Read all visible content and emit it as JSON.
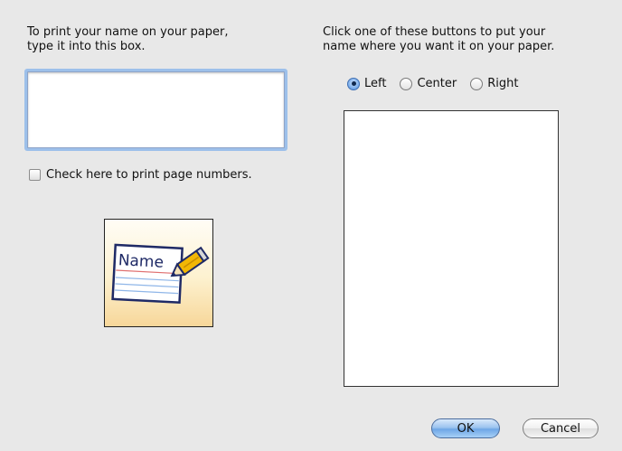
{
  "left_panel": {
    "instruction": "To print your name on your paper,\ntype it into this box.",
    "name_field": {
      "value": "",
      "placeholder": ""
    },
    "page_numbers_checkbox": {
      "label": "Check here to print page numbers.",
      "checked": false
    },
    "preview_icon": {
      "name": "name-tag-pencil-icon",
      "text": "Name"
    }
  },
  "right_panel": {
    "instruction": "Click one of these buttons to put your\nname where you want it on your paper.",
    "position_options": [
      {
        "label": "Left",
        "selected": true
      },
      {
        "label": "Center",
        "selected": false
      },
      {
        "label": "Right",
        "selected": false
      }
    ]
  },
  "buttons": {
    "ok": "OK",
    "cancel": "Cancel"
  },
  "colors": {
    "dialog_background": "#e8e8e8",
    "focus_ring": "#9dc0ea",
    "default_button": "#6ea6e6"
  }
}
